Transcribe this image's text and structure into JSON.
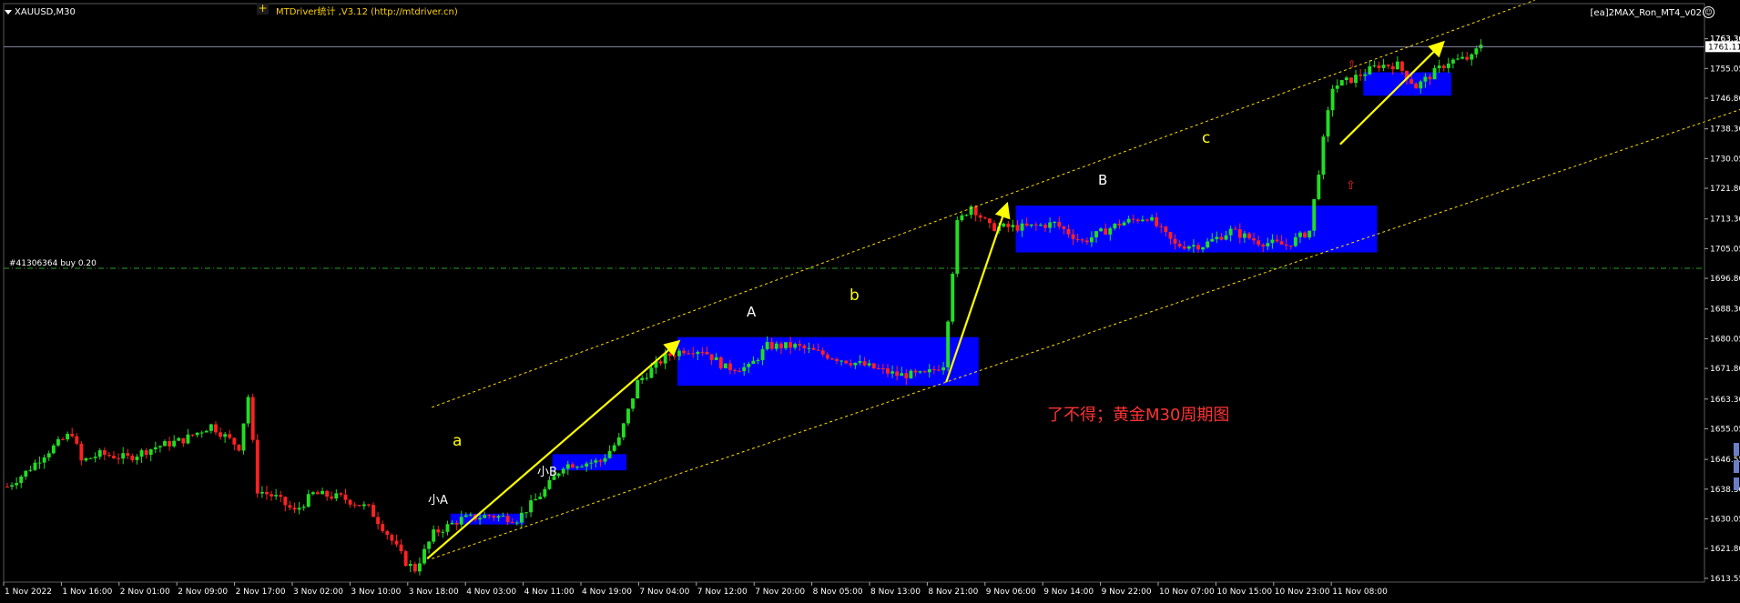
{
  "header": {
    "symbol": "XAUUSD,M30",
    "indicator": "MTDriver统计 ,V3.12 (http://mtdriver.cn)",
    "ea_label": "[ea]2MAX_Ron_MT4_v02"
  },
  "order_line": {
    "label": "#41306364 buy 0.20",
    "price": 1699.6
  },
  "price_labels": {
    "current": "1761.11",
    "top": "1763.30"
  },
  "watermark": "了不得；黄金M30周期图",
  "wave_labels": {
    "a": "a",
    "b": "b",
    "c": "c",
    "A": "A",
    "B": "B",
    "small_a": "小A",
    "small_b": "小B"
  },
  "colors": {
    "background": "#000000",
    "bull": "#22dd22",
    "bear": "#ff2222",
    "box": "#0000ff",
    "arrow": "#ffff00",
    "channel": "#ffdd00",
    "order_line": "#2aa12a",
    "watermark": "#ff3333"
  },
  "chart_data": {
    "type": "candlestick",
    "symbol": "XAUUSD",
    "timeframe": "M30",
    "y_ticks": [
      1613.55,
      1621.8,
      1630.05,
      1638.3,
      1646.55,
      1655.05,
      1663.3,
      1671.8,
      1680.05,
      1688.3,
      1696.8,
      1705.05,
      1713.3,
      1721.8,
      1730.05,
      1738.3,
      1746.8,
      1755.05,
      1763.3
    ],
    "ylim": [
      1612.5,
      1767.5
    ],
    "x_labels": [
      "1 Nov 2022",
      "1 Nov 16:00",
      "2 Nov 01:00",
      "2 Nov 09:00",
      "2 Nov 17:00",
      "3 Nov 02:00",
      "3 Nov 10:00",
      "3 Nov 18:00",
      "4 Nov 03:00",
      "4 Nov 11:00",
      "4 Nov 19:00",
      "7 Nov 04:00",
      "7 Nov 12:00",
      "7 Nov 20:00",
      "8 Nov 05:00",
      "8 Nov 13:00",
      "8 Nov 21:00",
      "9 Nov 06:00",
      "9 Nov 14:00",
      "9 Nov 22:00",
      "10 Nov 07:00",
      "10 Nov 15:00",
      "10 Nov 23:00",
      "11 Nov 08:00"
    ],
    "bar_count": 290,
    "path": [
      [
        0,
        1639
      ],
      [
        4,
        1643
      ],
      [
        8,
        1648
      ],
      [
        12,
        1652
      ],
      [
        14,
        1654
      ],
      [
        16,
        1646
      ],
      [
        20,
        1648
      ],
      [
        26,
        1647
      ],
      [
        32,
        1650
      ],
      [
        38,
        1652
      ],
      [
        44,
        1656
      ],
      [
        48,
        1652
      ],
      [
        50,
        1650
      ],
      [
        52,
        1664
      ],
      [
        54,
        1638
      ],
      [
        58,
        1636
      ],
      [
        62,
        1632
      ],
      [
        66,
        1637
      ],
      [
        72,
        1636
      ],
      [
        78,
        1633
      ],
      [
        82,
        1626
      ],
      [
        86,
        1618
      ],
      [
        88,
        1616
      ],
      [
        92,
        1626
      ],
      [
        98,
        1630
      ],
      [
        104,
        1631
      ],
      [
        110,
        1630
      ],
      [
        116,
        1638
      ],
      [
        120,
        1645
      ],
      [
        128,
        1646
      ],
      [
        132,
        1652
      ],
      [
        136,
        1668
      ],
      [
        142,
        1675
      ],
      [
        146,
        1677
      ],
      [
        150,
        1677
      ],
      [
        155,
        1672
      ],
      [
        160,
        1672
      ],
      [
        164,
        1678
      ],
      [
        170,
        1678
      ],
      [
        178,
        1675
      ],
      [
        184,
        1673
      ],
      [
        192,
        1670
      ],
      [
        198,
        1670
      ],
      [
        202,
        1673
      ],
      [
        205,
        1712
      ],
      [
        208,
        1717
      ],
      [
        212,
        1711
      ],
      [
        220,
        1711
      ],
      [
        226,
        1712
      ],
      [
        232,
        1707
      ],
      [
        240,
        1712
      ],
      [
        246,
        1714
      ],
      [
        252,
        1706
      ],
      [
        258,
        1706
      ],
      [
        264,
        1710
      ],
      [
        270,
        1707
      ],
      [
        276,
        1706
      ],
      [
        281,
        1710
      ],
      [
        284,
        1735
      ],
      [
        286,
        1750
      ],
      [
        290,
        1752
      ],
      [
        296,
        1756
      ],
      [
        300,
        1756
      ],
      [
        304,
        1750
      ],
      [
        306,
        1752
      ],
      [
        311,
        1757
      ],
      [
        316,
        1758
      ],
      [
        318,
        1762
      ]
    ],
    "rectangles": [
      {
        "label": "小A",
        "bars": [
          96,
          112
        ],
        "price": [
          1631.5,
          1628.5
        ]
      },
      {
        "label": "小B",
        "bars": [
          118,
          134
        ],
        "price": [
          1648.0,
          1643.5
        ]
      },
      {
        "label": "A",
        "bars": [
          145,
          210
        ],
        "price": [
          1680.5,
          1667.0
        ]
      },
      {
        "label": "B",
        "bars": [
          218,
          296
        ],
        "price": [
          1717.0,
          1704.0
        ]
      },
      {
        "label": "C",
        "bars": [
          293,
          312
        ],
        "price": [
          1754.0,
          1747.5
        ]
      }
    ],
    "arrows": [
      {
        "label": "a",
        "from": [
          91,
          1619
        ],
        "to": [
          145,
          1679
        ]
      },
      {
        "label": "b",
        "from": [
          203,
          1668
        ],
        "to": [
          216,
          1717
        ]
      },
      {
        "label": "c",
        "from": [
          288,
          1734
        ],
        "to": [
          310,
          1762
        ]
      }
    ],
    "channel": {
      "upper": [
        [
          92,
          1661
        ],
        [
          330,
          1774
        ]
      ],
      "lower": [
        [
          92,
          1619
        ],
        [
          400,
          1755
        ]
      ]
    },
    "last_price": 1761.11
  }
}
